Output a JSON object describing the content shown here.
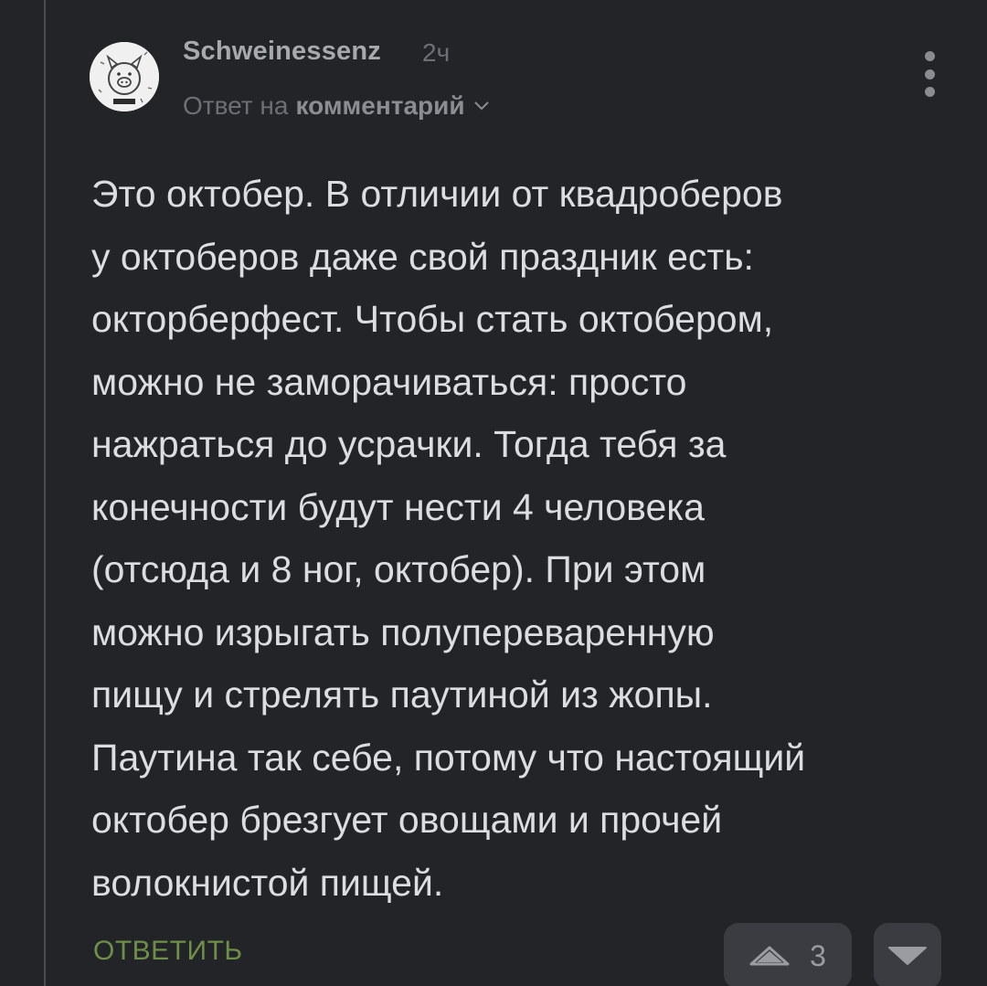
{
  "comment": {
    "author": "Schweinessenz",
    "time": "2ч",
    "reply_prefix": "Ответ на",
    "reply_link": "комментарий",
    "avatar_icon": "pig-avatar-icon",
    "text": "Это октобер. В отличии от квадроберов\nу октоберов даже свой праздник есть:\nокторберфест. Чтобы стать октобером,\nможно не заморачиваться: просто\nнажраться до усрачки. Тогда тебя за\nконечности будут нести 4 человека\n(отсюда и 8 ног, октобер). При этом\nможно изрыгать полупереваренную\nпищу и стрелять паутиной из жопы.\nПаутина так себе, потому что настоящий\nоктобер брезгует овощами и прочей\nволокнистой пищей.",
    "reply_button": "ОТВЕТИТЬ",
    "rating": "3"
  },
  "icons": {
    "menu": "more-vertical-icon",
    "chevron": "chevron-down-icon",
    "upvote": "upvote-triangle-icon",
    "downvote": "downvote-triangle-icon"
  },
  "colors": {
    "background": "#222428",
    "text": "#dcdde0",
    "muted": "#6d6f75",
    "accent_green": "#6f8f49",
    "button_bg": "#3a3c41"
  }
}
